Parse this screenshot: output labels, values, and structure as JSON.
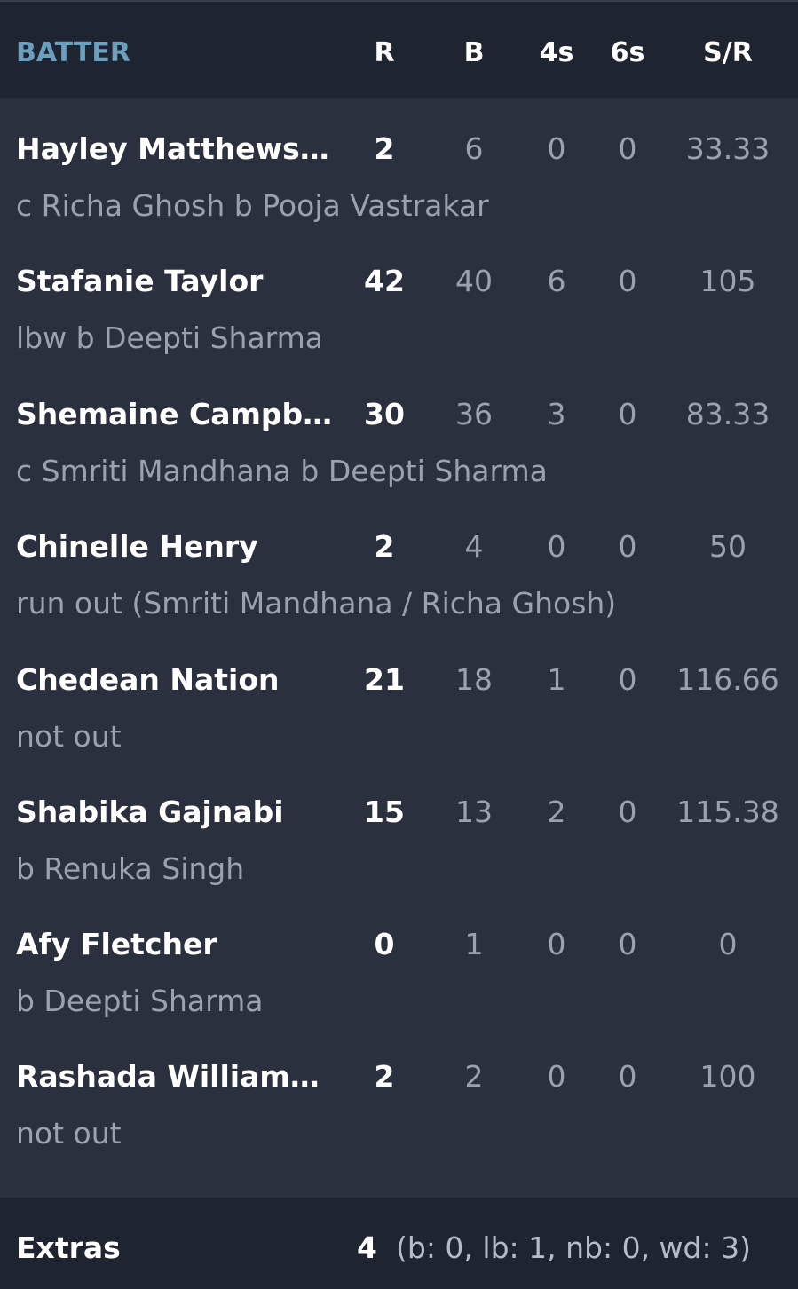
{
  "header": {
    "batter": "BATTER",
    "runs": "R",
    "balls": "B",
    "fours": "4s",
    "sixes": "6s",
    "strike_rate": "S/R"
  },
  "batters": [
    {
      "name": "Hayley Matthews ( c )",
      "runs": "2",
      "balls": "6",
      "fours": "0",
      "sixes": "0",
      "sr": "33.33",
      "dismissal": "c Richa Ghosh b Pooja Vastrakar"
    },
    {
      "name": "Stafanie Taylor",
      "runs": "42",
      "balls": "40",
      "fours": "6",
      "sixes": "0",
      "sr": "105",
      "dismissal": "lbw b Deepti Sharma"
    },
    {
      "name": "Shemaine Campbelle",
      "runs": "30",
      "balls": "36",
      "fours": "3",
      "sixes": "0",
      "sr": "83.33",
      "dismissal": "c Smriti Mandhana b Deepti Sharma"
    },
    {
      "name": "Chinelle Henry",
      "runs": "2",
      "balls": "4",
      "fours": "0",
      "sixes": "0",
      "sr": "50",
      "dismissal": "run out (Smriti Mandhana / Richa Ghosh)"
    },
    {
      "name": "Chedean Nation",
      "runs": "21",
      "balls": "18",
      "fours": "1",
      "sixes": "0",
      "sr": "116.66",
      "dismissal": "not out"
    },
    {
      "name": "Shabika Gajnabi",
      "runs": "15",
      "balls": "13",
      "fours": "2",
      "sixes": "0",
      "sr": "115.38",
      "dismissal": "b Renuka Singh"
    },
    {
      "name": "Afy Fletcher",
      "runs": "0",
      "balls": "1",
      "fours": "0",
      "sixes": "0",
      "sr": "0",
      "dismissal": "b Deepti Sharma"
    },
    {
      "name": "Rashada Williams (…",
      "runs": "2",
      "balls": "2",
      "fours": "0",
      "sixes": "0",
      "sr": "100",
      "dismissal": "not out"
    }
  ],
  "extras": {
    "label": "Extras",
    "total": "4",
    "detail": "(b: 0, lb: 1, nb: 0, wd: 3)"
  }
}
